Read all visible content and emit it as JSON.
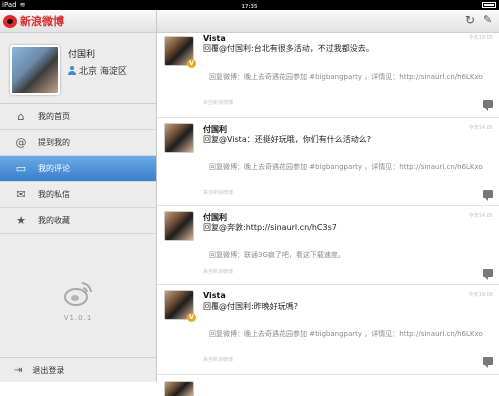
{
  "statusbar": {
    "carrier": "iPad",
    "time": "17:35"
  },
  "sidebar": {
    "logo_text": "新浪微博",
    "profile": {
      "name": "付国利",
      "location": "北京 海淀区"
    },
    "nav": [
      {
        "label": "我的首页",
        "icon": "home-icon",
        "glyph": "⌂"
      },
      {
        "label": "提到我的",
        "icon": "at-icon",
        "glyph": "@"
      },
      {
        "label": "我的评论",
        "icon": "comment-icon",
        "glyph": "▭",
        "active": true
      },
      {
        "label": "我的私信",
        "icon": "mail-icon",
        "glyph": "✉"
      },
      {
        "label": "我的收藏",
        "icon": "star-icon",
        "glyph": "★"
      }
    ],
    "version": "V1.0.1",
    "logout": "退出登录"
  },
  "colors": {
    "accent": "#3a7fcd",
    "logo_red": "#d92b2b",
    "vbadge": "#f0a818"
  },
  "feed": [
    {
      "user": "Vista",
      "time": "今天19:05",
      "verified": true,
      "text": "回覆@付国利:台北有很多活动，不过我都没去。",
      "repost": "回复微博：晚上去奇遇花园参加 #bigbangparty ，详情见：http://sinaurl.cn/h6LKxo",
      "source": "来自新浪微博"
    },
    {
      "user": "付国利",
      "time": "今天14:00",
      "verified": false,
      "text": "回复@Vista：还挺好玩哦，你们有什么活动么?",
      "repost": "回复微博：晚上去奇遇花园参加 #bigbangparty ，详情见：http://sinaurl.cn/h6LKxo",
      "source": "来自新浪微博"
    },
    {
      "user": "付国利",
      "time": "今天14:00",
      "verified": false,
      "text": "回复@奔敦:http://sinaurl.cn/hC3s7",
      "repost": "回复微博：联通3G疯了吧，看这下载速度。",
      "source": "来自新浪微博"
    },
    {
      "user": "Vista",
      "time": "今天19:08",
      "verified": true,
      "text": "回覆@付国利:昨晚好玩嗎?",
      "repost": "回复微博：晚上去奇遇花园参加 #bigbangparty ，详情见：http://sinaurl.cn/h6LKxo",
      "source": "来自新浪微博"
    }
  ]
}
